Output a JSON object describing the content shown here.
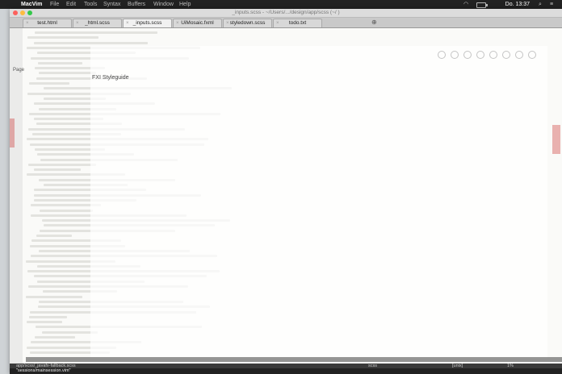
{
  "menubar": {
    "app_name": "MacVim",
    "menus": [
      "File",
      "Edit",
      "Tools",
      "Syntax",
      "Buffers",
      "Window",
      "Help"
    ],
    "clock": "Do. 13:37",
    "icons": [
      "apple-icon",
      "wifi-icon",
      "battery-icon",
      "spotlight-icon",
      "notification-icon"
    ]
  },
  "window": {
    "title": "_inputs.scss - ~/Users/.../design/app/scss (~/ )",
    "tabs": [
      {
        "label": "test.html",
        "active": false
      },
      {
        "label": "_html.scss",
        "active": false
      },
      {
        "label": "_inputs.scss",
        "active": true
      },
      {
        "label": "UiMosaic.fxml",
        "active": false
      },
      {
        "label": "styledown.scss",
        "active": false
      },
      {
        "label": "todo.txt",
        "active": false
      }
    ]
  },
  "overlay": {
    "page_label": "Page",
    "heading": "FXI Styleguide"
  },
  "status": {
    "left": "app/scss/_javafx-fallback.scss",
    "right_a": "scss",
    "right_b": "[unix]",
    "right_c": "1%",
    "cmd": "\"sessions/mainsession.vim\""
  }
}
